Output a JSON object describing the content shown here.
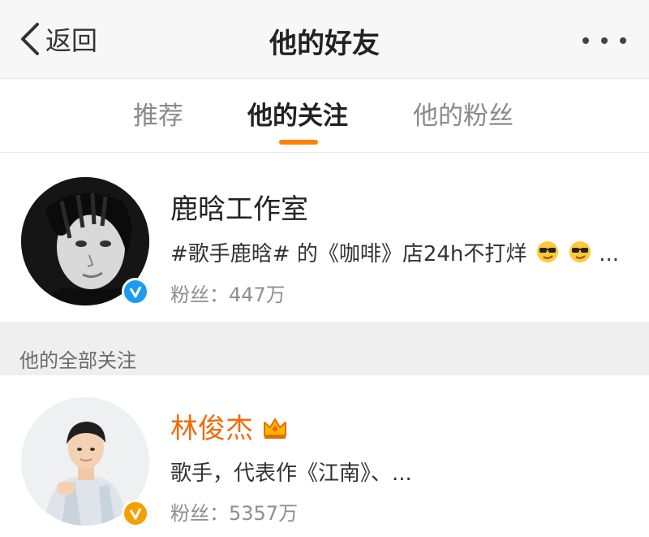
{
  "nav": {
    "back_label": "返回",
    "title": "他的好友",
    "back_icon": "chevron-left-icon",
    "more_icon": "more-icon"
  },
  "tabs": [
    {
      "label": "推荐",
      "active": false
    },
    {
      "label": "他的关注",
      "active": true
    },
    {
      "label": "他的粉丝",
      "active": false
    }
  ],
  "colors": {
    "accent": "#ff8200",
    "vip_name": "#f26b0a",
    "verified_blue": "#1d9bf0",
    "verified_gold": "#f5a000"
  },
  "featured": {
    "name": "鹿晗工作室",
    "description": "#歌手鹿晗# 的《咖啡》店24h不打烊",
    "description_suffix": "...",
    "fans": "粉丝：447万",
    "verified_badge": "blue-verified-icon",
    "emojis": [
      "sunglasses-emoji",
      "sunglasses-emoji"
    ]
  },
  "section": {
    "label": "他的全部关注"
  },
  "users": [
    {
      "name": "林俊杰",
      "crown_icon": "crown-icon",
      "description": "歌手，代表作《江南》、...",
      "fans": "粉丝：5357万",
      "verified_badge": "gold-verified-icon"
    }
  ]
}
